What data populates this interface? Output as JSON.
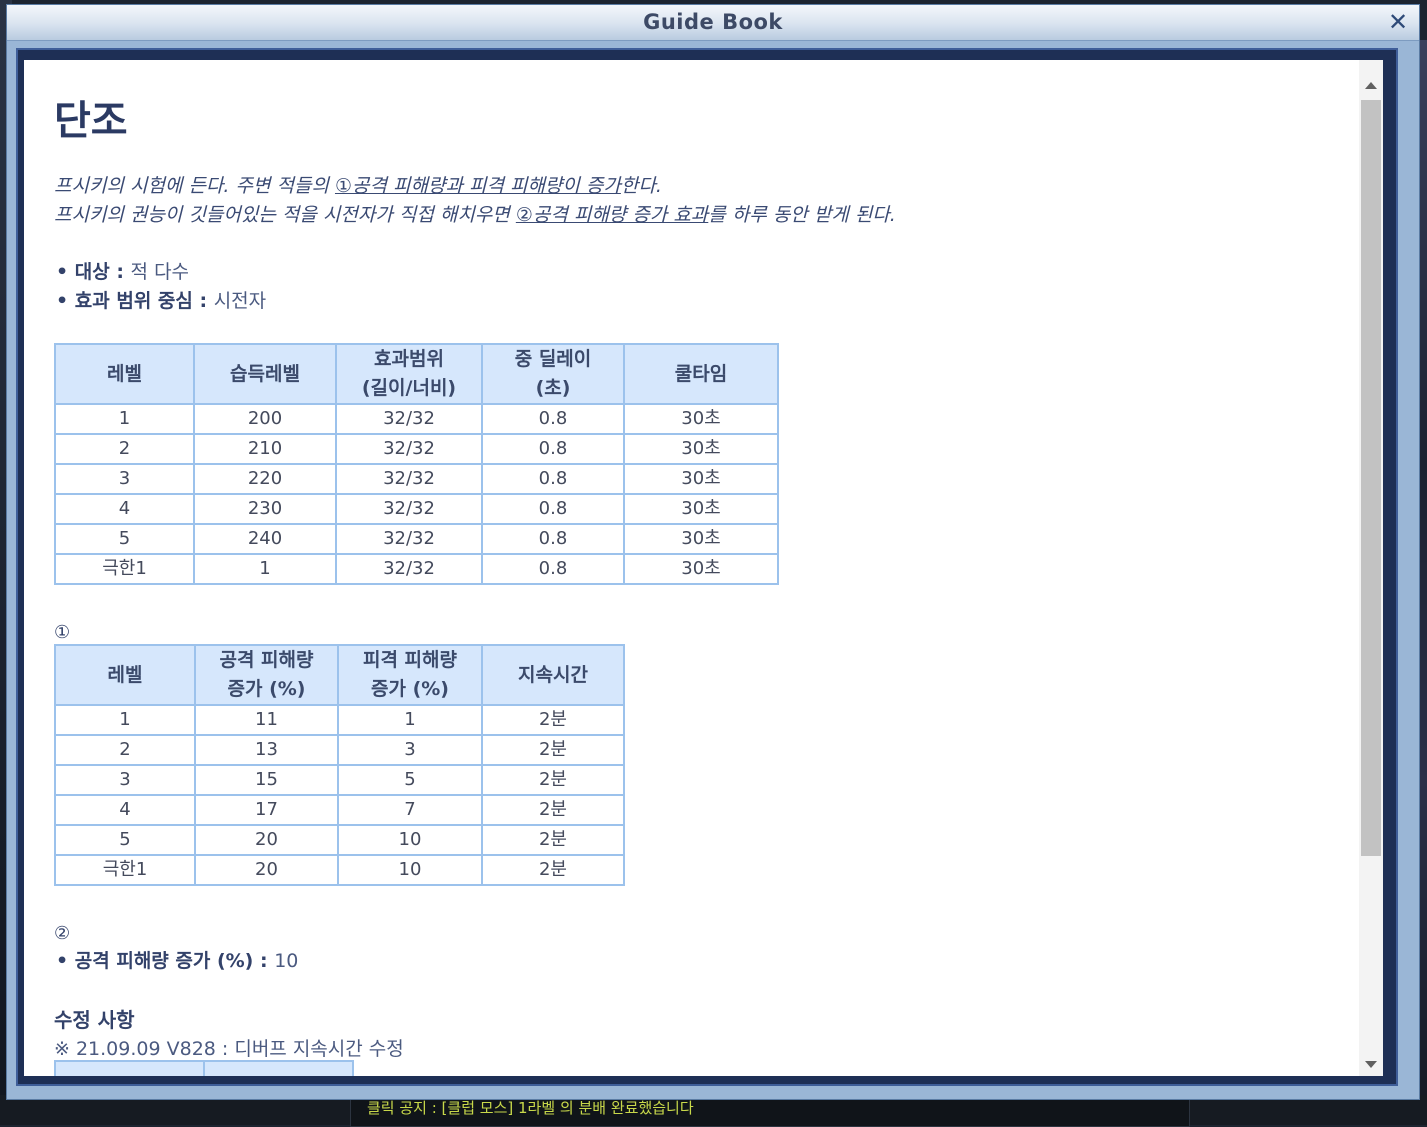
{
  "window": {
    "title": "Guide Book",
    "close_glyph": "✕"
  },
  "page": {
    "title": "단조",
    "desc1_a": "프시키의 시험에 든다. 주변 적들의 ",
    "desc1_link": "①공격 피해량과 피격 피해량이 증가",
    "desc1_b": "한다.",
    "desc2_a": "프시키의 권능이 깃들어있는 적을 시전자가 직접 해치우면 ",
    "desc2_link": "②공격 피해량 증가 효과",
    "desc2_b": "를 하루 동안 받게 된다.",
    "bullets": [
      {
        "label": "• 대상 : ",
        "value": "적 다수"
      },
      {
        "label": "• 효과 범위 중심 : ",
        "value": "시전자"
      }
    ],
    "table1": {
      "headers": [
        "레벨",
        "습득레벨",
        "효과범위\n(길이/너비)",
        "중 딜레이\n(초)",
        "쿨타임"
      ],
      "rows": [
        [
          "1",
          "200",
          "32/32",
          "0.8",
          "30초"
        ],
        [
          "2",
          "210",
          "32/32",
          "0.8",
          "30초"
        ],
        [
          "3",
          "220",
          "32/32",
          "0.8",
          "30초"
        ],
        [
          "4",
          "230",
          "32/32",
          "0.8",
          "30초"
        ],
        [
          "5",
          "240",
          "32/32",
          "0.8",
          "30초"
        ],
        [
          "극한1",
          "1",
          "32/32",
          "0.8",
          "30초"
        ]
      ]
    },
    "note1": "①",
    "table2": {
      "headers": [
        "레벨",
        "공격 피해량\n증가 (%)",
        "피격 피해량\n증가 (%)",
        "지속시간"
      ],
      "rows": [
        [
          "1",
          "11",
          "1",
          "2분"
        ],
        [
          "2",
          "13",
          "3",
          "2분"
        ],
        [
          "3",
          "15",
          "5",
          "2분"
        ],
        [
          "4",
          "17",
          "7",
          "2분"
        ],
        [
          "5",
          "20",
          "10",
          "2분"
        ],
        [
          "극한1",
          "20",
          "10",
          "2분"
        ]
      ]
    },
    "note2": "②",
    "bullet3": {
      "label": "• 공격 피해량 증가 (%) : ",
      "value": "10"
    },
    "changes_heading": "수정 사항",
    "changelog": "※ 21.09.09 V828 : 디버프 지속시간 수정"
  },
  "chat": {
    "line1": "클릭 공지 : [클럽 모스] 1라벨 의 분배 완료했습니다"
  }
}
